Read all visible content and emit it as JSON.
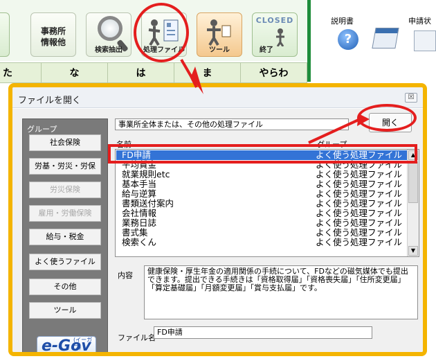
{
  "toolbar": {
    "jimusho_label_1": "事務所",
    "jimusho_label_2": "情報他",
    "search_label": "検索抽出",
    "process_file_label": "処理ファイル",
    "tool_label": "ツール",
    "closed_top": "CLOSED",
    "closed_label": "終了",
    "help_label": "説明書",
    "help_glyph": "?",
    "shinsei_label": "申請状"
  },
  "kana_row": [
    "た",
    "な",
    "は",
    "ま",
    "やらわ"
  ],
  "dialog": {
    "title": "ファイルを開く",
    "close_glyph": "☒",
    "group_label": "グループ",
    "groups": [
      {
        "label": "社会保険",
        "enabled": true
      },
      {
        "label": "労基・労災・労保",
        "enabled": true
      },
      {
        "label": "労災保険",
        "enabled": false
      },
      {
        "label": "雇用・労働保険",
        "enabled": false
      },
      {
        "label": "給与・税金",
        "enabled": true
      },
      {
        "label": "よく使うファイル",
        "enabled": true
      },
      {
        "label": "その他",
        "enabled": true
      },
      {
        "label": "ツール",
        "enabled": true
      }
    ],
    "egov_e": "e-Gov",
    "egov_ruby": "(イーガブ)",
    "category": "事業所全体または、その他の処理ファイル",
    "open_button": "開く",
    "col_name": "名前",
    "col_group": "グループ",
    "files": [
      {
        "name": "FD申請",
        "group": "よく使う処理ファイル"
      },
      {
        "name": "平均賃金",
        "group": "よく使う処理ファイル"
      },
      {
        "name": "就業規則etc",
        "group": "よく使う処理ファイル"
      },
      {
        "name": "基本手当",
        "group": "よく使う処理ファイル"
      },
      {
        "name": "給与逆算",
        "group": "よく使う処理ファイル"
      },
      {
        "name": "書類送付案内",
        "group": "よく使う処理ファイル"
      },
      {
        "name": "会社情報",
        "group": "よく使う処理ファイル"
      },
      {
        "name": "業務日誌",
        "group": "よく使う処理ファイル"
      },
      {
        "name": "書式集",
        "group": "よく使う処理ファイル"
      },
      {
        "name": "検索くん",
        "group": "よく使う処理ファイル"
      }
    ],
    "selected_index": 0,
    "scroll_up": "▲",
    "scroll_down": "▼",
    "content_label": "内容",
    "content_text": "健康保険・厚生年金の適用関係の手続について、FDなどの磁気媒体でも提出できます。提出できる手続きは「資格取得届」「資格喪失届」「住所変更届」「算定基礎届」「月額変更届」「賞与支払届」です。",
    "filename_label": "ファイル名",
    "filename_value": "FD申請"
  },
  "colors": {
    "dialog_border": "#f4b400",
    "annotation": "#e41e1e",
    "selection": "#3373d6",
    "ribbon_green": "#1f8d3c"
  }
}
